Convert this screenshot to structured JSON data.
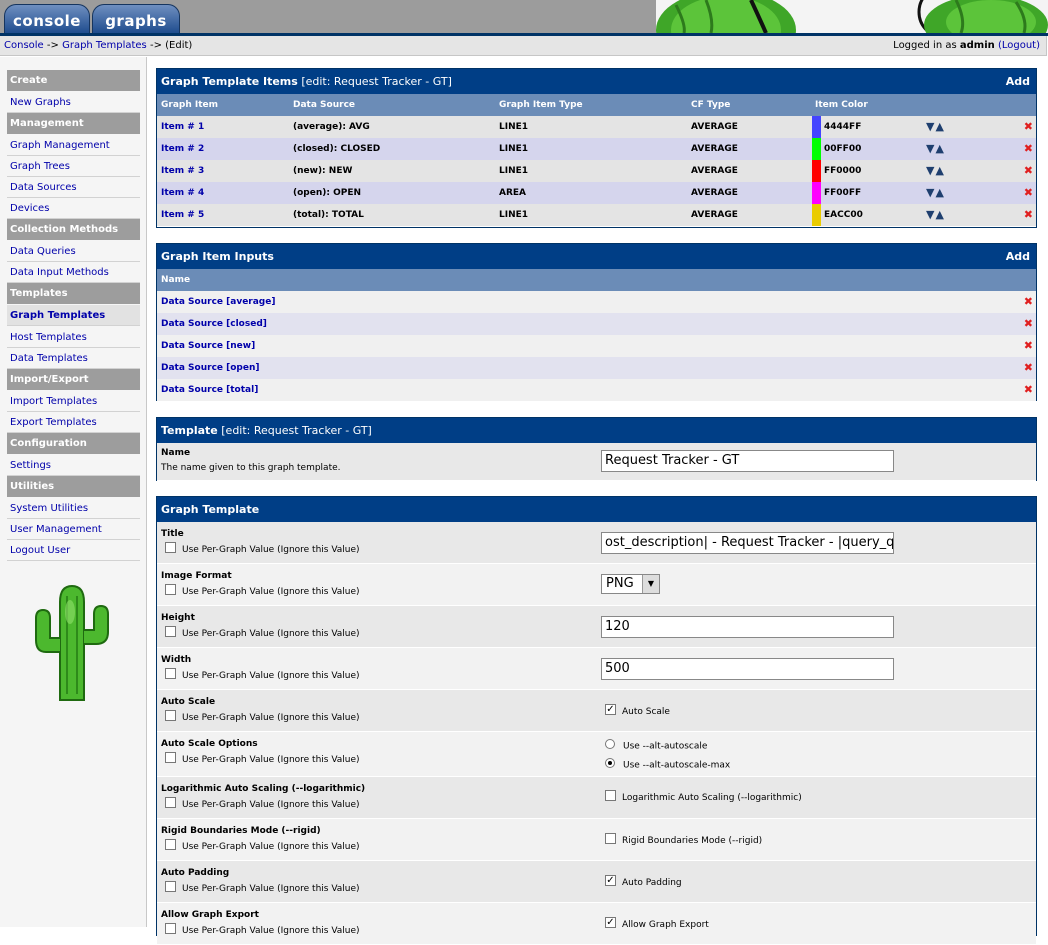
{
  "tabs": {
    "console": "console",
    "graphs": "graphs"
  },
  "breadcrumb": {
    "console": "Console",
    "sep1": "->",
    "graph_templates": "Graph Templates",
    "sep2": "->",
    "current": "(Edit)"
  },
  "login": {
    "prefix": "Logged in as",
    "user": "admin",
    "logout": "(Logout)"
  },
  "sidebar": {
    "create": "Create",
    "new_graphs": "New Graphs",
    "management": "Management",
    "graph_management": "Graph Management",
    "graph_trees": "Graph Trees",
    "data_sources": "Data Sources",
    "devices": "Devices",
    "collection_methods": "Collection Methods",
    "data_queries": "Data Queries",
    "data_input_methods": "Data Input Methods",
    "templates": "Templates",
    "graph_templates": "Graph Templates",
    "host_templates": "Host Templates",
    "data_templates": "Data Templates",
    "import_export": "Import/Export",
    "import_templates": "Import Templates",
    "export_templates": "Export Templates",
    "configuration": "Configuration",
    "settings": "Settings",
    "utilities": "Utilities",
    "system_utilities": "System Utilities",
    "user_management": "User Management",
    "logout_user": "Logout User"
  },
  "items_panel": {
    "title_bold": "Graph Template Items",
    "title_rest": "[edit: Request Tracker - GT]",
    "add": "Add",
    "columns": {
      "item": "Graph Item",
      "source": "Data Source",
      "type": "Graph Item Type",
      "cf": "CF Type",
      "color": "Item Color"
    },
    "rows": [
      {
        "item": "Item # 1",
        "source": "(average): AVG",
        "type": "LINE1",
        "cf": "AVERAGE",
        "color": "4444FF",
        "hex": "#4444FF"
      },
      {
        "item": "Item # 2",
        "source": "(closed): CLOSED",
        "type": "LINE1",
        "cf": "AVERAGE",
        "color": "00FF00",
        "hex": "#00FF00"
      },
      {
        "item": "Item # 3",
        "source": "(new): NEW",
        "type": "LINE1",
        "cf": "AVERAGE",
        "color": "FF0000",
        "hex": "#FF0000"
      },
      {
        "item": "Item # 4",
        "source": "(open): OPEN",
        "type": "AREA",
        "cf": "AVERAGE",
        "color": "FF00FF",
        "hex": "#FF00FF"
      },
      {
        "item": "Item # 5",
        "source": "(total): TOTAL",
        "type": "LINE1",
        "cf": "AVERAGE",
        "color": "EACC00",
        "hex": "#EACC00"
      }
    ]
  },
  "inputs_panel": {
    "title": "Graph Item Inputs",
    "add": "Add",
    "column": "Name",
    "rows": [
      "Data Source [average]",
      "Data Source [closed]",
      "Data Source [new]",
      "Data Source [open]",
      "Data Source [total]"
    ]
  },
  "template_panel": {
    "title_bold": "Template",
    "title_rest": "[edit: Request Tracker - GT]",
    "name_label": "Name",
    "name_desc": "The name given to this graph template.",
    "name_value": "Request Tracker - GT"
  },
  "graph_panel": {
    "title": "Graph Template",
    "per_graph": "Use Per-Graph Value (Ignore this Value)",
    "title_label": "Title",
    "title_value": "ost_description| - Request Tracker - |query_queue",
    "image_format_label": "Image Format",
    "image_format_value": "PNG",
    "height_label": "Height",
    "height_value": "120",
    "width_label": "Width",
    "width_value": "500",
    "auto_scale_label": "Auto Scale",
    "auto_scale_opt": "Auto Scale",
    "auto_scale_options_label": "Auto Scale Options",
    "alt_autoscale": "Use --alt-autoscale",
    "alt_autoscale_max": "Use --alt-autoscale-max",
    "log_label": "Logarithmic Auto Scaling (--logarithmic)",
    "log_opt": "Logarithmic Auto Scaling (--logarithmic)",
    "rigid_label": "Rigid Boundaries Mode (--rigid)",
    "rigid_opt": "Rigid Boundaries Mode (--rigid)",
    "padding_label": "Auto Padding",
    "padding_opt": "Auto Padding",
    "export_label": "Allow Graph Export",
    "export_opt": "Allow Graph Export"
  },
  "colors": {
    "header": "#003E86",
    "subheader": "#6B8CB7",
    "sidebar_head": "#9D9D9D"
  }
}
